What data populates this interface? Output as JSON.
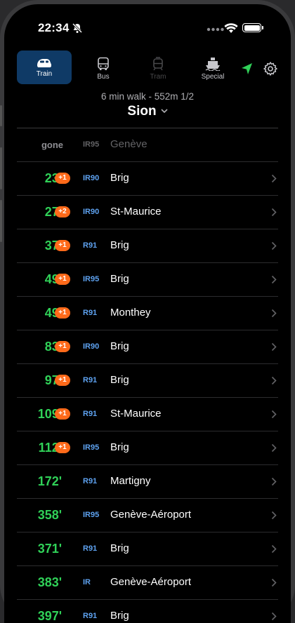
{
  "status": {
    "time": "22:34"
  },
  "tabs": [
    {
      "label": "Train",
      "icon": "train-icon",
      "active": true
    },
    {
      "label": "Bus",
      "icon": "bus-icon"
    },
    {
      "label": "Tram",
      "icon": "tram-icon"
    },
    {
      "label": "Special",
      "icon": "ship-icon"
    }
  ],
  "location": {
    "walk": "6 min walk - 552m  1/2",
    "station": "Sion"
  },
  "departures": [
    {
      "mins": "gone",
      "delay": "",
      "line": "IR95",
      "dest": "Genève",
      "gone": true
    },
    {
      "mins": "23'",
      "delay": "+1",
      "line": "IR90",
      "dest": "Brig"
    },
    {
      "mins": "27'",
      "delay": "+2",
      "line": "IR90",
      "dest": "St-Maurice"
    },
    {
      "mins": "37'",
      "delay": "+1",
      "line": "R91",
      "dest": "Brig"
    },
    {
      "mins": "49'",
      "delay": "+1",
      "line": "IR95",
      "dest": "Brig"
    },
    {
      "mins": "49'",
      "delay": "+1",
      "line": "R91",
      "dest": "Monthey"
    },
    {
      "mins": "83'",
      "delay": "+1",
      "line": "IR90",
      "dest": "Brig"
    },
    {
      "mins": "97'",
      "delay": "+1",
      "line": "R91",
      "dest": "Brig"
    },
    {
      "mins": "109'",
      "delay": "+1",
      "line": "R91",
      "dest": "St-Maurice"
    },
    {
      "mins": "112'",
      "delay": "+1",
      "line": "IR95",
      "dest": "Brig"
    },
    {
      "mins": "172'",
      "delay": "",
      "line": "R91",
      "dest": "Martigny"
    },
    {
      "mins": "358'",
      "delay": "",
      "line": "IR95",
      "dest": "Genève-Aéroport"
    },
    {
      "mins": "371'",
      "delay": "",
      "line": "R91",
      "dest": "Brig"
    },
    {
      "mins": "383'",
      "delay": "",
      "line": "IR",
      "dest": "Genève-Aéroport"
    },
    {
      "mins": "397'",
      "delay": "",
      "line": "R91",
      "dest": "Brig"
    }
  ],
  "colors": {
    "accent": "#0f3a66",
    "minutes": "#30d158",
    "delay": "#ff6a1a",
    "line": "#5ea2f0"
  }
}
